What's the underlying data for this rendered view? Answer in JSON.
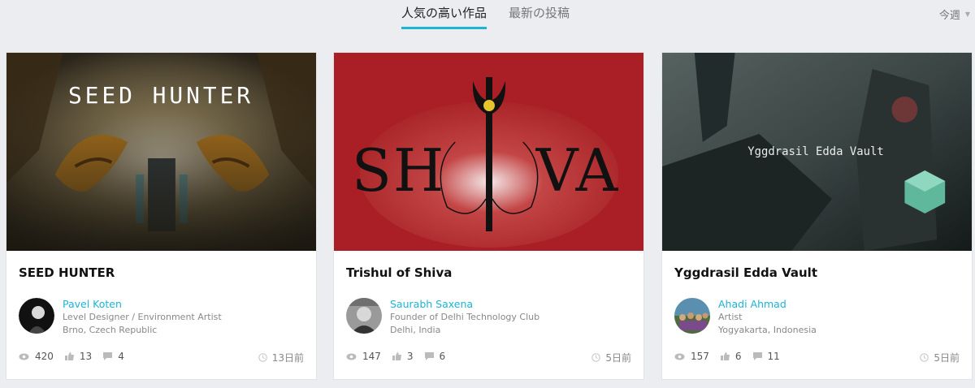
{
  "tabs": [
    {
      "label": "人気の高い作品",
      "active": true
    },
    {
      "label": "最新の投稿",
      "active": false
    }
  ],
  "period": {
    "label": "今週"
  },
  "accent_color": "#1bb4d6",
  "cards": [
    {
      "art_text": "SEED HUNTER",
      "title": "SEED HUNTER",
      "author": "Pavel Koten",
      "role": "Level Designer / Environment Artist",
      "location": "Brno, Czech Republic",
      "views": "420",
      "likes": "13",
      "comments": "4",
      "time": "13日前"
    },
    {
      "art_text_left": "SH",
      "art_text_right": "VA",
      "title": "Trishul of Shiva",
      "author": "Saurabh Saxena",
      "role": "Founder of Delhi Technology Club",
      "location": "Delhi, India",
      "views": "147",
      "likes": "3",
      "comments": "6",
      "time": "5日前"
    },
    {
      "art_text": "Yggdrasil Edda Vault",
      "title": "Yggdrasil Edda Vault",
      "author": "Ahadi Ahmad",
      "role": "Artist",
      "location": "Yogyakarta, Indonesia",
      "views": "157",
      "likes": "6",
      "comments": "11",
      "time": "5日前"
    }
  ],
  "icons": [
    "eye-icon",
    "thumbs-up-icon",
    "comment-icon",
    "clock-icon",
    "chevron-down-icon"
  ]
}
